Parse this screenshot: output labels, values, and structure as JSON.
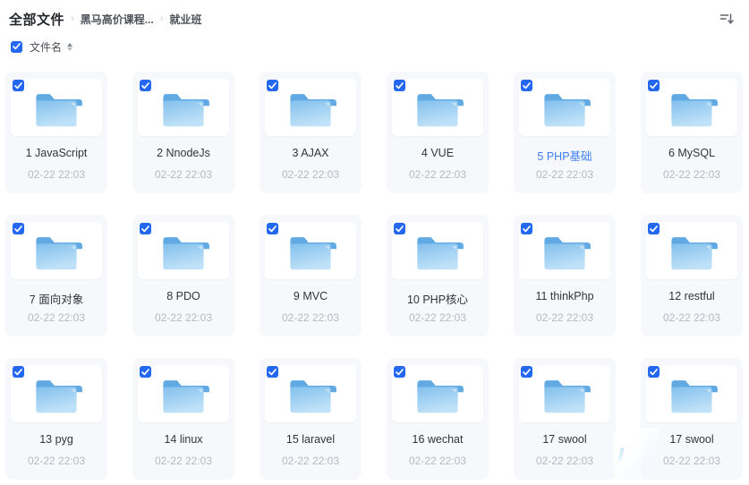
{
  "page": {
    "accent_color": "#2468f2",
    "card_bg_color": "#f6f8fc",
    "highlight_text_color": "#3d7ff2"
  },
  "header": {
    "title": "全部文件",
    "separator": "›",
    "breadcrumbs": [
      {
        "label": "黑马高价课程..."
      },
      {
        "label": "就业班"
      }
    ],
    "sort_icon": "sort-descending-icon"
  },
  "toolbar": {
    "select_all_checked": true,
    "sort_field_label": "文件名",
    "sort_caret_icon": "sort-caret-updown-icon"
  },
  "files": {
    "items": [
      {
        "name": "1 JavaScript",
        "date": "02-22 22:03",
        "selected": true
      },
      {
        "name": "2 NnodeJs",
        "date": "02-22 22:03",
        "selected": true
      },
      {
        "name": "3 AJAX",
        "date": "02-22 22:03",
        "selected": true
      },
      {
        "name": "4 VUE",
        "date": "02-22 22:03",
        "selected": true
      },
      {
        "name": "5 PHP基础",
        "date": "02-22 22:03",
        "selected": true,
        "highlighted": true
      },
      {
        "name": "6 MySQL",
        "date": "02-22 22:03",
        "selected": true
      },
      {
        "name": "7 面向对象",
        "date": "02-22 22:03",
        "selected": true
      },
      {
        "name": "8 PDO",
        "date": "02-22 22:03",
        "selected": true
      },
      {
        "name": "9 MVC",
        "date": "02-22 22:03",
        "selected": true
      },
      {
        "name": "10 PHP核心",
        "date": "02-22 22:03",
        "selected": true
      },
      {
        "name": "11 thinkPhp",
        "date": "02-22 22:03",
        "selected": true
      },
      {
        "name": "12 restful",
        "date": "02-22 22:03",
        "selected": true
      },
      {
        "name": "13 pyg",
        "date": "02-22 22:03",
        "selected": true
      },
      {
        "name": "14 linux",
        "date": "02-22 22:03",
        "selected": true
      },
      {
        "name": "15 laravel",
        "date": "02-22 22:03",
        "selected": true
      },
      {
        "name": "16 wechat",
        "date": "02-22 22:03",
        "selected": true
      },
      {
        "name": "17 swool",
        "date": "02-22 22:03",
        "selected": true
      },
      {
        "name": "17 swool",
        "date": "02-22 22:03",
        "selected": true
      }
    ]
  }
}
